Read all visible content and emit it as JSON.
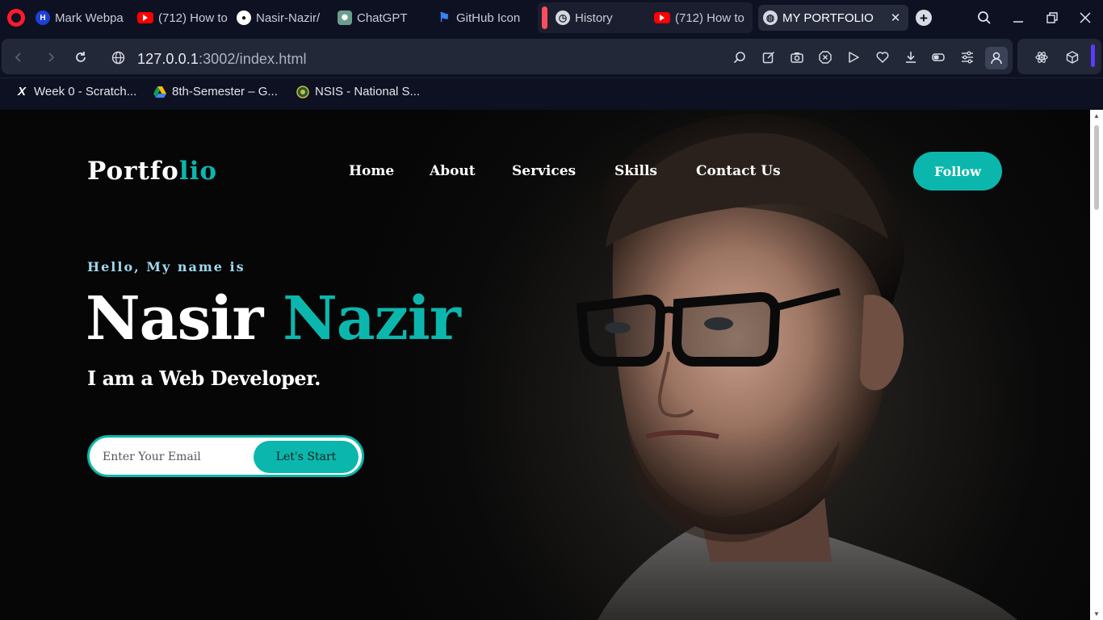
{
  "browser": {
    "tabs": [
      {
        "label": "Mark Webpa",
        "favicon": "H"
      },
      {
        "label": "(712) How to",
        "favicon": "youtube-icon"
      },
      {
        "label": "Nasir-Nazir/",
        "favicon": "github-icon"
      },
      {
        "label": "ChatGPT",
        "favicon": "chatgpt-icon"
      },
      {
        "label": "GitHub Icon",
        "favicon": "flag-icon"
      },
      {
        "label": "History",
        "favicon": "clock-icon"
      },
      {
        "label": "(712) How to",
        "favicon": "youtube-icon"
      },
      {
        "label": "MY PORTFOLIO",
        "favicon": "globe-icon",
        "active": true
      }
    ],
    "close_glyph": "✕",
    "new_tab_glyph": "+",
    "url_host": "127.0.0.1",
    "url_path": ":3002/index.html",
    "bookmarks": [
      {
        "label": "Week 0 - Scratch...",
        "icon": "X"
      },
      {
        "label": "8th-Semester – G...",
        "icon": "drive-icon"
      },
      {
        "label": "NSIS - National S...",
        "icon": "seal-icon"
      }
    ]
  },
  "page": {
    "logo_main": "Portfo",
    "logo_accent": "lio",
    "nav": [
      "Home",
      "About",
      "Services",
      "Skills",
      "Contact Us"
    ],
    "follow_label": "Follow",
    "greeting": "Hello, My name is",
    "first_name": "Nasir",
    "last_name": "Nazir",
    "role": "I am a Web Developer.",
    "email_placeholder": "Enter Your Email",
    "cta_label": "Let's Start"
  },
  "colors": {
    "accent": "#0bb7ad",
    "greeting": "#9fd9f0",
    "browser_bg": "#0e1122",
    "toolbar_bg": "#232839"
  }
}
